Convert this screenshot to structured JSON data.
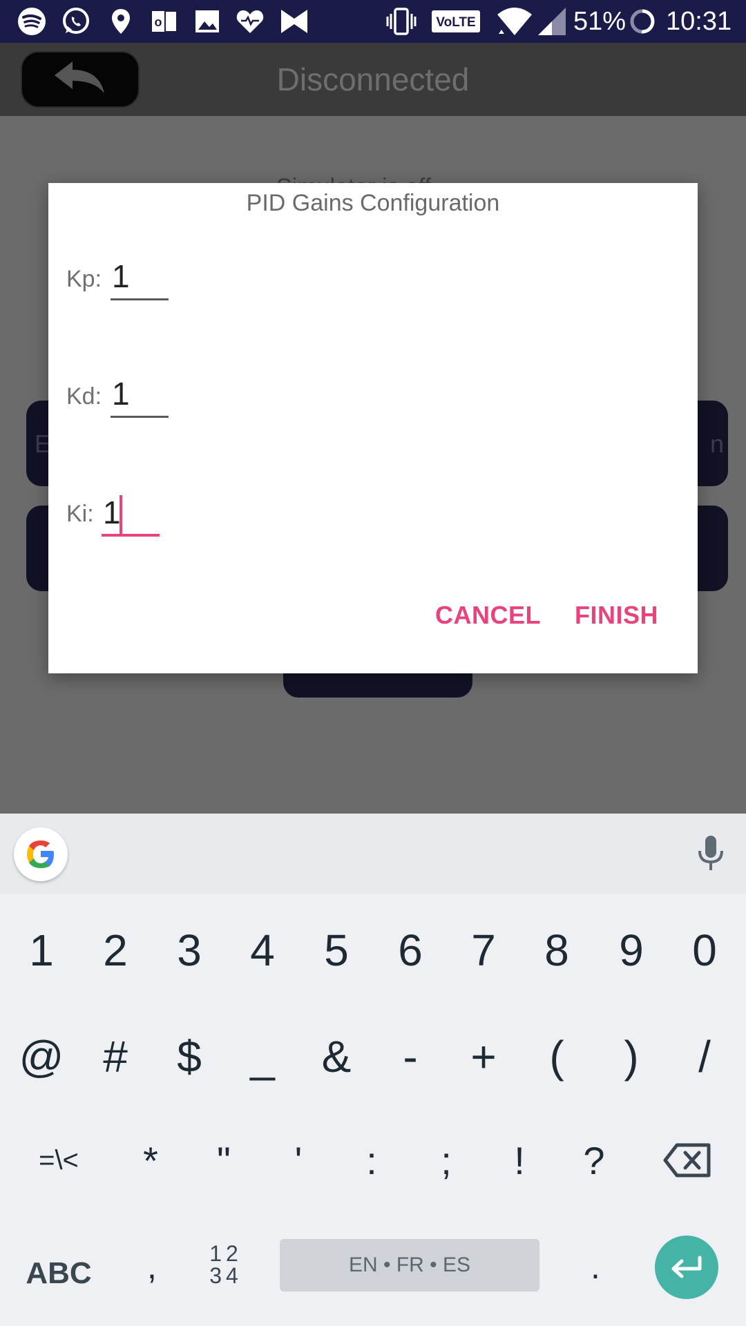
{
  "status_bar": {
    "battery": "51%",
    "time": "10:31",
    "network_badge": "VoLTE",
    "icons": [
      "spotify-icon",
      "whatsapp-icon",
      "location-icon",
      "outlook-icon",
      "gallery-icon",
      "health-icon",
      "bowtie-icon",
      "vibrate-icon",
      "volte-icon",
      "wifi-icon",
      "signal-icon",
      "battery-icon"
    ]
  },
  "app_bar": {
    "title": "Disconnected"
  },
  "background": {
    "partial_text": "Simulator is off",
    "btn1_left": "E",
    "btn1_right": "n"
  },
  "dialog": {
    "title": "PID Gains Configuration",
    "fields": [
      {
        "label": "Kp:",
        "value": "1"
      },
      {
        "label": "Kd:",
        "value": "1"
      },
      {
        "label": "Ki:",
        "value": "1"
      }
    ],
    "cancel_label": "CANCEL",
    "finish_label": "FINISH",
    "accent_color": "#e9437e"
  },
  "keyboard": {
    "row1": [
      "1",
      "2",
      "3",
      "4",
      "5",
      "6",
      "7",
      "8",
      "9",
      "0"
    ],
    "row2": [
      "@",
      "#",
      "$",
      "_",
      "&",
      "-",
      "+",
      "(",
      ")",
      "/"
    ],
    "row3": [
      "=\\<",
      "*",
      "\"",
      "'",
      ":",
      ";",
      "!",
      "?"
    ],
    "abc_label": "ABC",
    "comma": ",",
    "numpad_label_top": "12",
    "numpad_label_bottom": "34",
    "spacebar_label": "EN • FR • ES",
    "period": ".",
    "enter_color": "#45b3a6"
  }
}
